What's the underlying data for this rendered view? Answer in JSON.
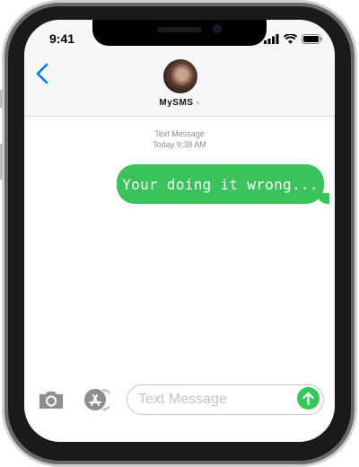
{
  "status_bar": {
    "time": "9:41"
  },
  "header": {
    "contact_name": "MySMS",
    "chevron": "›"
  },
  "conversation": {
    "service": "Text Message",
    "timestamp": "Today 9:38 AM",
    "messages": [
      {
        "direction": "outgoing",
        "text": "Your doing it wrong..."
      }
    ]
  },
  "composer": {
    "placeholder": "Text Message"
  },
  "colors": {
    "bubble": "#3ac35a",
    "accent": "#007aff",
    "send": "#34c759"
  }
}
